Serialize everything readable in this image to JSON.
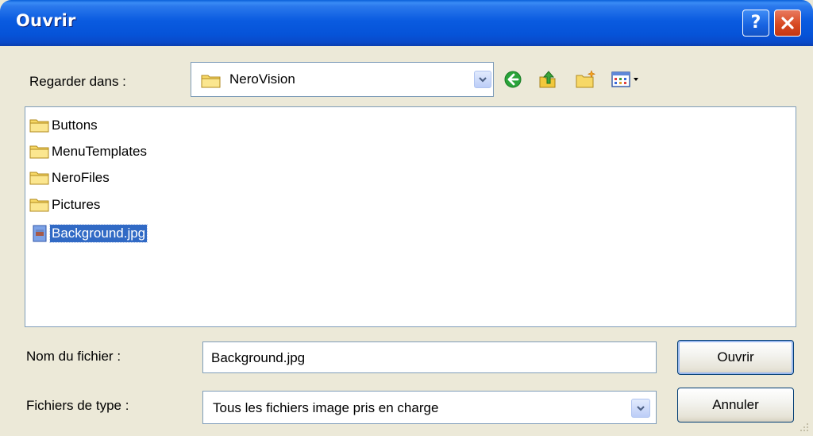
{
  "window": {
    "title": "Ouvrir",
    "help_icon": "question-mark-icon",
    "close_icon": "close-x-icon"
  },
  "lookin": {
    "label": "Regarder dans :",
    "value": "NeroVision",
    "icon": "folder-icon"
  },
  "toolbar": {
    "back_icon": "back-arrow-icon",
    "up_icon": "up-folder-icon",
    "new_folder_icon": "new-folder-icon",
    "view_icon": "view-menu-icon"
  },
  "files": [
    {
      "name": "Buttons",
      "type": "folder",
      "selected": false
    },
    {
      "name": "MenuTemplates",
      "type": "folder",
      "selected": false
    },
    {
      "name": "NeroFiles",
      "type": "folder",
      "selected": false
    },
    {
      "name": "Pictures",
      "type": "folder",
      "selected": false
    },
    {
      "name": "Background.jpg",
      "type": "image",
      "selected": true
    }
  ],
  "filename": {
    "label": "Nom du fichier :",
    "value": "Background.jpg"
  },
  "filetype": {
    "label": "Fichiers de type :",
    "value": "Tous les fichiers image pris en charge"
  },
  "buttons": {
    "open": "Ouvrir",
    "cancel": "Annuler"
  },
  "colors": {
    "titlebar": "#0a5be0",
    "selection": "#316ac5",
    "dialog_bg": "#ece9d8"
  }
}
